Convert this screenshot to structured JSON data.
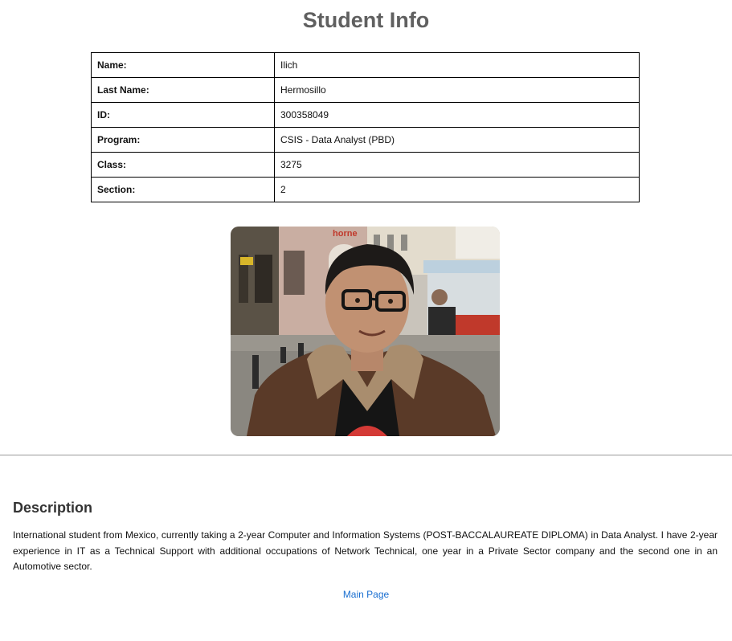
{
  "page": {
    "title": "Student Info"
  },
  "student_info": {
    "rows": [
      {
        "label": "Name:",
        "value": "Ilich"
      },
      {
        "label": "Last Name:",
        "value": "Hermosillo"
      },
      {
        "label": "ID:",
        "value": "300358049"
      },
      {
        "label": "Program:",
        "value": "CSIS - Data Analyst (PBD)"
      },
      {
        "label": "Class:",
        "value": "3275"
      },
      {
        "label": "Section:",
        "value": "2"
      }
    ]
  },
  "photo": {
    "storefront_sign": "horne"
  },
  "description": {
    "heading": "Description",
    "text": "International student from Mexico, currently taking a 2-year Computer and Information Systems (POST-BACCALAUREATE DIPLOMA) in Data Analyst. I have 2-year experience in IT as a Technical Support with additional occupations of Network Technical, one year in a Private Sector company and the second one in an Automotive sector."
  },
  "footer": {
    "main_link_label": "Main Page"
  },
  "colors": {
    "title": "#606060",
    "link": "#1a6fd1",
    "divider": "#9a9a9a"
  }
}
